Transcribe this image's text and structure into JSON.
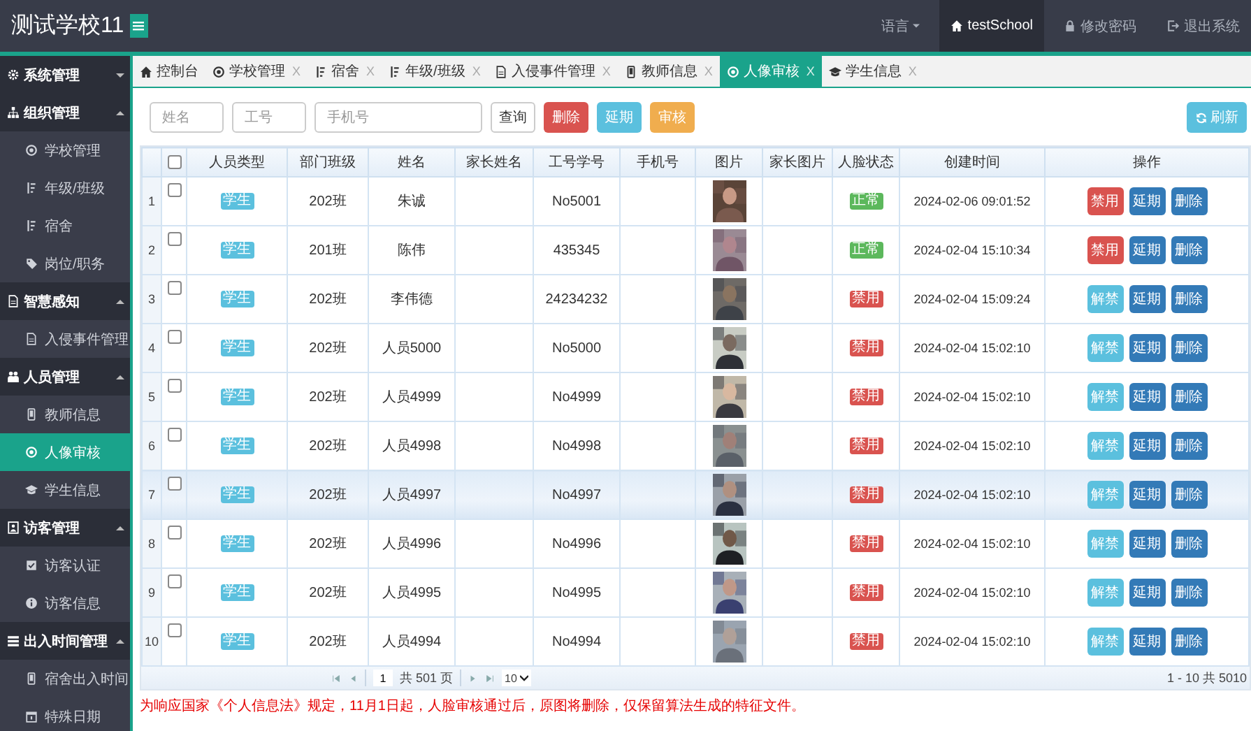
{
  "header": {
    "title": "测试学校11",
    "nav": [
      {
        "kind": "dropdown",
        "label": "语言",
        "selected": false
      },
      {
        "kind": "home",
        "label": "testSchool",
        "selected": true
      },
      {
        "kind": "lock",
        "label": "修改密码",
        "selected": false
      },
      {
        "kind": "exit",
        "label": "退出系统",
        "selected": false
      }
    ]
  },
  "sidebar": {
    "groups": [
      {
        "label": "系统管理",
        "expanded": false
      },
      {
        "label": "组织管理",
        "expanded": true,
        "children": [
          {
            "label": "学校管理",
            "selected": false
          },
          {
            "label": "年级/班级",
            "selected": false
          },
          {
            "label": "宿舍",
            "selected": false
          },
          {
            "label": "岗位/职务",
            "selected": false
          }
        ]
      },
      {
        "label": "智慧感知",
        "expanded": true,
        "children": [
          {
            "label": "入侵事件管理",
            "selected": false
          }
        ]
      },
      {
        "label": "人员管理",
        "expanded": true,
        "children": [
          {
            "label": "教师信息",
            "selected": false
          },
          {
            "label": "人像审核",
            "selected": true
          },
          {
            "label": "学生信息",
            "selected": false
          }
        ]
      },
      {
        "label": "访客管理",
        "expanded": true,
        "children": [
          {
            "label": "访客认证",
            "selected": false
          },
          {
            "label": "访客信息",
            "selected": false
          }
        ]
      },
      {
        "label": "出入时间管理",
        "expanded": true,
        "children": [
          {
            "label": "宿舍出入时间",
            "selected": false
          },
          {
            "label": "特殊日期",
            "selected": false
          }
        ]
      }
    ]
  },
  "tabs": [
    {
      "label": "控制台",
      "selected": false
    },
    {
      "label": "学校管理",
      "close": "X",
      "selected": false
    },
    {
      "label": "宿舍",
      "close": "X",
      "selected": false
    },
    {
      "label": "年级/班级",
      "close": "X",
      "selected": false
    },
    {
      "label": "入侵事件管理",
      "close": "X",
      "selected": false
    },
    {
      "label": "教师信息",
      "close": "X",
      "selected": false
    },
    {
      "label": "人像审核",
      "close": "X",
      "selected": true
    },
    {
      "label": "学生信息",
      "close": "X",
      "selected": false
    }
  ],
  "toolbar": {
    "fields": [
      {
        "placeholder": "姓名"
      },
      {
        "placeholder": "工号"
      },
      {
        "placeholder": "手机号"
      }
    ],
    "buttons": [
      {
        "label": "查询",
        "kind": "default"
      },
      {
        "label": "删除",
        "kind": "danger"
      },
      {
        "label": "延期",
        "kind": "info"
      },
      {
        "label": "审核",
        "kind": "warning"
      }
    ],
    "refresh": {
      "label": "刷新",
      "kind": "info"
    }
  },
  "table": {
    "columns": [
      "人员类型",
      "部门班级",
      "姓名",
      "家长姓名",
      "工号学号",
      "手机号",
      "图片",
      "家长图片",
      "人脸状态",
      "创建时间",
      "操作"
    ],
    "rows": [
      {
        "index": "1",
        "checked": false,
        "highlighted": false,
        "type": "学生",
        "dept": "202班",
        "name": "朱诚",
        "staff_no": "No5001",
        "photo": {
          "kind": "picture"
        },
        "status": {
          "label": "正常",
          "kind": "ok"
        },
        "created": "2024-02-06 09:01:52",
        "actions": [
          {
            "label": "禁用",
            "kind": "danger"
          },
          {
            "label": "延期",
            "kind": "primary"
          },
          {
            "label": "删除",
            "kind": "primary"
          }
        ]
      },
      {
        "index": "2",
        "checked": false,
        "highlighted": false,
        "type": "学生",
        "dept": "201班",
        "name": "陈伟",
        "staff_no": "435345",
        "photo": {
          "kind": "picture"
        },
        "status": {
          "label": "正常",
          "kind": "ok"
        },
        "created": "2024-02-04 15:10:34",
        "actions": [
          {
            "label": "禁用",
            "kind": "danger"
          },
          {
            "label": "延期",
            "kind": "primary"
          },
          {
            "label": "删除",
            "kind": "primary"
          }
        ]
      },
      {
        "index": "3",
        "checked": false,
        "highlighted": false,
        "type": "学生",
        "dept": "202班",
        "name": "李伟德",
        "staff_no": "24234232",
        "photo": {
          "kind": "picture"
        },
        "status": {
          "label": "禁用",
          "kind": "banned"
        },
        "created": "2024-02-04 15:09:24",
        "actions": [
          {
            "label": "解禁",
            "kind": "info"
          },
          {
            "label": "延期",
            "kind": "primary"
          },
          {
            "label": "删除",
            "kind": "primary"
          }
        ]
      },
      {
        "index": "4",
        "checked": false,
        "highlighted": false,
        "type": "学生",
        "dept": "202班",
        "name": "人员5000",
        "staff_no": "No5000",
        "photo": {
          "kind": "picture"
        },
        "status": {
          "label": "禁用",
          "kind": "banned"
        },
        "created": "2024-02-04 15:02:10",
        "actions": [
          {
            "label": "解禁",
            "kind": "info"
          },
          {
            "label": "延期",
            "kind": "primary"
          },
          {
            "label": "删除",
            "kind": "primary"
          }
        ]
      },
      {
        "index": "5",
        "checked": false,
        "highlighted": false,
        "type": "学生",
        "dept": "202班",
        "name": "人员4999",
        "staff_no": "No4999",
        "photo": {
          "kind": "picture"
        },
        "status": {
          "label": "禁用",
          "kind": "banned"
        },
        "created": "2024-02-04 15:02:10",
        "actions": [
          {
            "label": "解禁",
            "kind": "info"
          },
          {
            "label": "延期",
            "kind": "primary"
          },
          {
            "label": "删除",
            "kind": "primary"
          }
        ]
      },
      {
        "index": "6",
        "checked": false,
        "highlighted": false,
        "type": "学生",
        "dept": "202班",
        "name": "人员4998",
        "staff_no": "No4998",
        "photo": {
          "kind": "picture"
        },
        "status": {
          "label": "禁用",
          "kind": "banned"
        },
        "created": "2024-02-04 15:02:10",
        "actions": [
          {
            "label": "解禁",
            "kind": "info"
          },
          {
            "label": "延期",
            "kind": "primary"
          },
          {
            "label": "删除",
            "kind": "primary"
          }
        ]
      },
      {
        "index": "7",
        "checked": false,
        "highlighted": true,
        "type": "学生",
        "dept": "202班",
        "name": "人员4997",
        "staff_no": "No4997",
        "photo": {
          "kind": "picture"
        },
        "status": {
          "label": "禁用",
          "kind": "banned"
        },
        "created": "2024-02-04 15:02:10",
        "actions": [
          {
            "label": "解禁",
            "kind": "info"
          },
          {
            "label": "延期",
            "kind": "primary"
          },
          {
            "label": "删除",
            "kind": "primary"
          }
        ]
      },
      {
        "index": "8",
        "checked": false,
        "highlighted": false,
        "type": "学生",
        "dept": "202班",
        "name": "人员4996",
        "staff_no": "No4996",
        "photo": {
          "kind": "picture"
        },
        "status": {
          "label": "禁用",
          "kind": "banned"
        },
        "created": "2024-02-04 15:02:10",
        "actions": [
          {
            "label": "解禁",
            "kind": "info"
          },
          {
            "label": "延期",
            "kind": "primary"
          },
          {
            "label": "删除",
            "kind": "primary"
          }
        ]
      },
      {
        "index": "9",
        "checked": false,
        "highlighted": false,
        "type": "学生",
        "dept": "202班",
        "name": "人员4995",
        "staff_no": "No4995",
        "photo": {
          "kind": "picture"
        },
        "status": {
          "label": "禁用",
          "kind": "banned"
        },
        "created": "2024-02-04 15:02:10",
        "actions": [
          {
            "label": "解禁",
            "kind": "info"
          },
          {
            "label": "延期",
            "kind": "primary"
          },
          {
            "label": "删除",
            "kind": "primary"
          }
        ]
      },
      {
        "index": "10",
        "checked": false,
        "highlighted": false,
        "type": "学生",
        "dept": "202班",
        "name": "人员4994",
        "staff_no": "No4994",
        "photo": {
          "kind": "picture"
        },
        "status": {
          "label": "禁用",
          "kind": "banned"
        },
        "created": "2024-02-04 15:02:10",
        "actions": [
          {
            "label": "解禁",
            "kind": "info"
          },
          {
            "label": "延期",
            "kind": "primary"
          },
          {
            "label": "删除",
            "kind": "primary"
          }
        ]
      }
    ],
    "header_checkbox": {
      "checked": false
    }
  },
  "pager": {
    "page": "1",
    "total_pages": "共 501 页",
    "page_size": "10",
    "summary": "1 - 10 共 5010"
  },
  "notice": "为响应国家《个人信息法》规定，11月1日起，人脸审核通过后，原图将删除，仅保留算法生成的特征文件。"
}
